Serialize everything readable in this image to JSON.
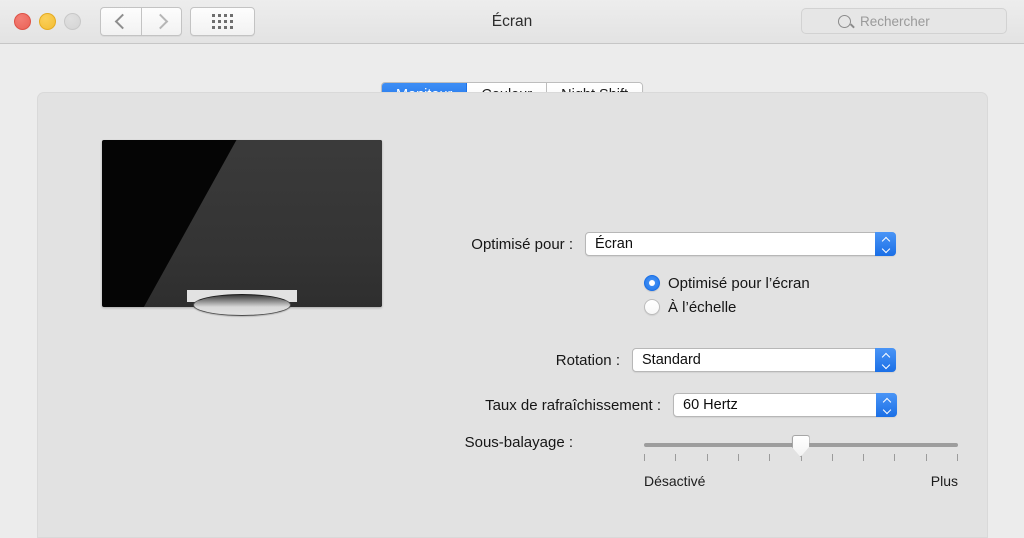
{
  "window": {
    "title": "Écran",
    "traffic_lights": [
      "close",
      "minimize",
      "zoom"
    ]
  },
  "toolbar": {
    "back_label": "Précédent",
    "forward_label": "Suivant",
    "grid_label": "Tout afficher",
    "search": {
      "placeholder": "Rechercher",
      "value": "",
      "icon": "search-icon"
    }
  },
  "tabs": [
    {
      "label": "Moniteur",
      "active": true
    },
    {
      "label": "Couleur",
      "active": false
    },
    {
      "label": "Night Shift",
      "active": false
    }
  ],
  "preview": {
    "device": "tv-illustration"
  },
  "form": {
    "optimized_for": {
      "label": "Optimisé pour :",
      "value": "Écran",
      "options": [
        "Écran"
      ]
    },
    "resolution_options": [
      {
        "label": "Optimisé pour l’écran",
        "selected": true
      },
      {
        "label": "À l’échelle",
        "selected": false
      }
    ],
    "rotation": {
      "label": "Rotation :",
      "value": "Standard",
      "options": [
        "Standard"
      ]
    },
    "refresh_rate": {
      "label": "Taux de rafraîchissement :",
      "value": "60 Hertz",
      "options": [
        "60 Hertz"
      ]
    },
    "underscan": {
      "label": "Sous-balayage :",
      "min_label": "Désactivé",
      "max_label": "Plus",
      "tick_count": 11,
      "value_index": 5,
      "value_percent": 50
    }
  },
  "colors": {
    "accent": "#1d72e8",
    "window_bg": "#ececec",
    "panel_bg": "#e2e2e2",
    "close": "#ea6256",
    "minimize": "#f3bd33",
    "zoom": "#d4d4d4"
  }
}
